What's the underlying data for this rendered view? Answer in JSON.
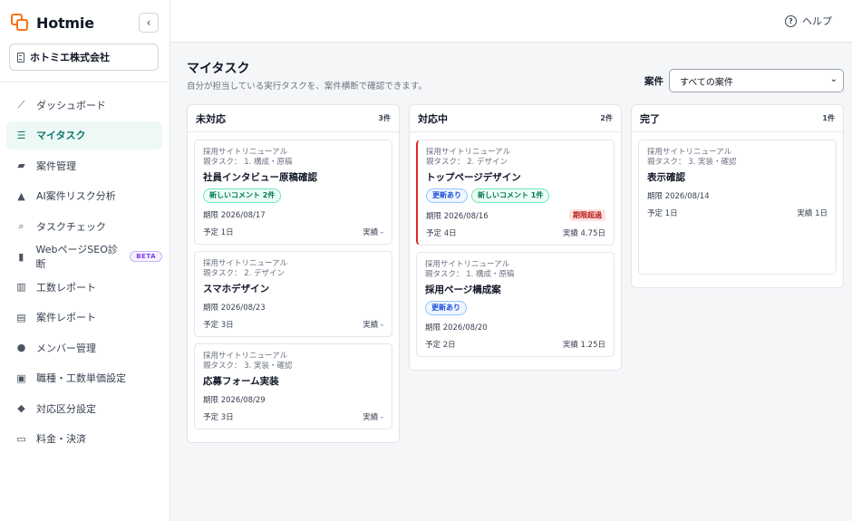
{
  "app": {
    "name": "Hotmie",
    "brand_color": "#f97316",
    "accent_color": "#0f766e"
  },
  "organization": {
    "name": "ホトミエ株式会社"
  },
  "sidebar": {
    "items": [
      {
        "label": "ダッシュボード",
        "icon": "chart-line-icon",
        "active": false
      },
      {
        "label": "マイタスク",
        "icon": "task-list-icon",
        "active": true
      },
      {
        "label": "案件管理",
        "icon": "folder-icon",
        "active": false
      },
      {
        "label": "AI案件リスク分析",
        "icon": "warning-icon",
        "active": false
      },
      {
        "label": "タスクチェック",
        "icon": "search-icon",
        "active": false
      },
      {
        "label": "WebページSEO診断",
        "icon": "clipboard-check-icon",
        "active": false,
        "badge": "BETA"
      },
      {
        "label": "工数レポート",
        "icon": "bar-chart-icon",
        "active": false
      },
      {
        "label": "案件レポート",
        "icon": "document-icon",
        "active": false
      },
      {
        "label": "メンバー管理",
        "icon": "users-icon",
        "active": false
      },
      {
        "label": "職種・工数単価設定",
        "icon": "briefcase-icon",
        "active": false
      },
      {
        "label": "対応区分設定",
        "icon": "tags-icon",
        "active": false
      },
      {
        "label": "料金・決済",
        "icon": "credit-card-icon",
        "active": false
      }
    ]
  },
  "header": {
    "help_label": "ヘルプ"
  },
  "main": {
    "title": "マイタスク",
    "description": "自分が担当している実行タスクを、案件横断で確認できます。",
    "filter": {
      "label": "案件",
      "selected": "すべての案件"
    }
  },
  "columns": [
    {
      "title": "未対応",
      "count": "3件",
      "cards": [
        {
          "project": "採用サイトリニューアル",
          "parent": "親タスク： 1. 構成・原稿",
          "title": "社員インタビュー原稿確認",
          "badges": [
            {
              "label": "新しいコメント 2件",
              "color": "green"
            }
          ],
          "due": "期限 2026/08/17",
          "overdue_label": "",
          "plan": "予定 1日",
          "actual": "実績 -"
        },
        {
          "project": "採用サイトリニューアル",
          "parent": "親タスク： 2. デザイン",
          "title": "スマホデザイン",
          "badges": [],
          "due": "期限 2026/08/23",
          "overdue_label": "",
          "plan": "予定 3日",
          "actual": "実績 -"
        },
        {
          "project": "採用サイトリニューアル",
          "parent": "親タスク： 3. 実装・確認",
          "title": "応募フォーム実装",
          "badges": [],
          "due": "期限 2026/08/29",
          "overdue_label": "",
          "plan": "予定 3日",
          "actual": "実績 -"
        }
      ]
    },
    {
      "title": "対応中",
      "count": "2件",
      "cards": [
        {
          "project": "採用サイトリニューアル",
          "parent": "親タスク： 2. デザイン",
          "title": "トップページデザイン",
          "badges": [
            {
              "label": "更新あり",
              "color": "blue"
            },
            {
              "label": "新しいコメント 1件",
              "color": "green"
            }
          ],
          "due": "期限 2026/08/16",
          "overdue_label": "期限超過",
          "plan": "予定 4日",
          "actual": "実績 4.75日"
        },
        {
          "project": "採用サイトリニューアル",
          "parent": "親タスク： 1. 構成・原稿",
          "title": "採用ページ構成案",
          "badges": [
            {
              "label": "更新あり",
              "color": "blue"
            }
          ],
          "due": "期限 2026/08/20",
          "overdue_label": "",
          "plan": "予定 2日",
          "actual": "実績 1.25日"
        }
      ]
    },
    {
      "title": "完了",
      "count": "1件",
      "cards": [
        {
          "project": "採用サイトリニューアル",
          "parent": "親タスク： 3. 実装・確認",
          "title": "表示確認",
          "badges": [],
          "due": "期限 2026/08/14",
          "overdue_label": "",
          "plan": "予定 1日",
          "actual": "実績 1日",
          "tall": true
        }
      ]
    }
  ]
}
